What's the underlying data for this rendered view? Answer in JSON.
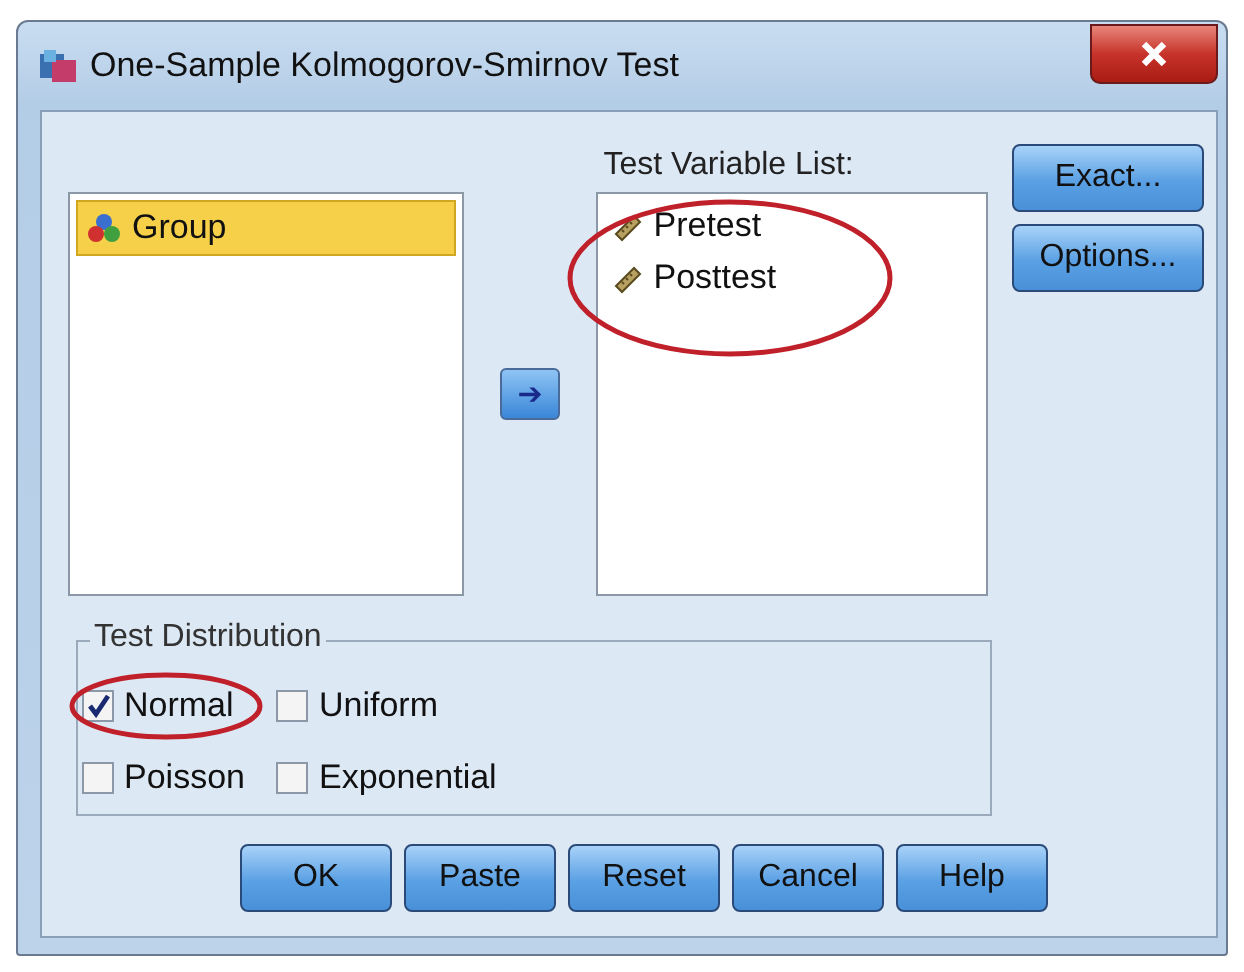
{
  "window": {
    "title": "One-Sample Kolmogorov-Smirnov Test"
  },
  "source_list": {
    "items": [
      {
        "label": "Group",
        "kind": "nominal",
        "selected": true
      }
    ]
  },
  "move_button": {
    "label": "➔"
  },
  "test_variable_list": {
    "label": "Test Variable List:",
    "items": [
      {
        "label": "Pretest",
        "kind": "scale",
        "selected": false
      },
      {
        "label": "Posttest",
        "kind": "scale",
        "selected": false
      }
    ]
  },
  "side_buttons": [
    "Exact...",
    "Options..."
  ],
  "test_distribution": {
    "title": "Test Distribution",
    "options": [
      {
        "label": "Normal",
        "checked": true
      },
      {
        "label": "Uniform",
        "checked": false
      },
      {
        "label": "Poisson",
        "checked": false
      },
      {
        "label": "Exponential",
        "checked": false
      }
    ]
  },
  "buttons": [
    "OK",
    "Paste",
    "Reset",
    "Cancel",
    "Help"
  ]
}
